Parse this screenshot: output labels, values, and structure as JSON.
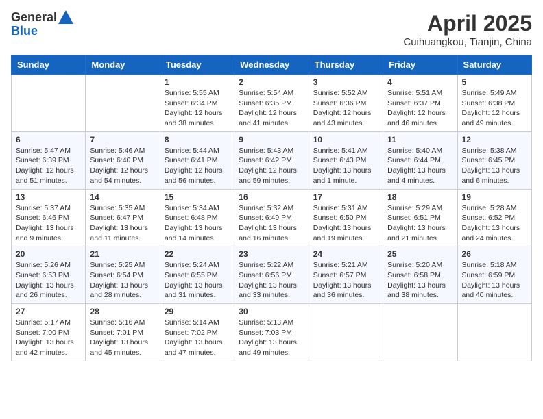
{
  "header": {
    "logo_general": "General",
    "logo_blue": "Blue",
    "month_title": "April 2025",
    "subtitle": "Cuihuangkou, Tianjin, China"
  },
  "weekdays": [
    "Sunday",
    "Monday",
    "Tuesday",
    "Wednesday",
    "Thursday",
    "Friday",
    "Saturday"
  ],
  "weeks": [
    [
      {
        "day": "",
        "sunrise": "",
        "sunset": "",
        "daylight": ""
      },
      {
        "day": "",
        "sunrise": "",
        "sunset": "",
        "daylight": ""
      },
      {
        "day": "1",
        "sunrise": "Sunrise: 5:55 AM",
        "sunset": "Sunset: 6:34 PM",
        "daylight": "Daylight: 12 hours and 38 minutes."
      },
      {
        "day": "2",
        "sunrise": "Sunrise: 5:54 AM",
        "sunset": "Sunset: 6:35 PM",
        "daylight": "Daylight: 12 hours and 41 minutes."
      },
      {
        "day": "3",
        "sunrise": "Sunrise: 5:52 AM",
        "sunset": "Sunset: 6:36 PM",
        "daylight": "Daylight: 12 hours and 43 minutes."
      },
      {
        "day": "4",
        "sunrise": "Sunrise: 5:51 AM",
        "sunset": "Sunset: 6:37 PM",
        "daylight": "Daylight: 12 hours and 46 minutes."
      },
      {
        "day": "5",
        "sunrise": "Sunrise: 5:49 AM",
        "sunset": "Sunset: 6:38 PM",
        "daylight": "Daylight: 12 hours and 49 minutes."
      }
    ],
    [
      {
        "day": "6",
        "sunrise": "Sunrise: 5:47 AM",
        "sunset": "Sunset: 6:39 PM",
        "daylight": "Daylight: 12 hours and 51 minutes."
      },
      {
        "day": "7",
        "sunrise": "Sunrise: 5:46 AM",
        "sunset": "Sunset: 6:40 PM",
        "daylight": "Daylight: 12 hours and 54 minutes."
      },
      {
        "day": "8",
        "sunrise": "Sunrise: 5:44 AM",
        "sunset": "Sunset: 6:41 PM",
        "daylight": "Daylight: 12 hours and 56 minutes."
      },
      {
        "day": "9",
        "sunrise": "Sunrise: 5:43 AM",
        "sunset": "Sunset: 6:42 PM",
        "daylight": "Daylight: 12 hours and 59 minutes."
      },
      {
        "day": "10",
        "sunrise": "Sunrise: 5:41 AM",
        "sunset": "Sunset: 6:43 PM",
        "daylight": "Daylight: 13 hours and 1 minute."
      },
      {
        "day": "11",
        "sunrise": "Sunrise: 5:40 AM",
        "sunset": "Sunset: 6:44 PM",
        "daylight": "Daylight: 13 hours and 4 minutes."
      },
      {
        "day": "12",
        "sunrise": "Sunrise: 5:38 AM",
        "sunset": "Sunset: 6:45 PM",
        "daylight": "Daylight: 13 hours and 6 minutes."
      }
    ],
    [
      {
        "day": "13",
        "sunrise": "Sunrise: 5:37 AM",
        "sunset": "Sunset: 6:46 PM",
        "daylight": "Daylight: 13 hours and 9 minutes."
      },
      {
        "day": "14",
        "sunrise": "Sunrise: 5:35 AM",
        "sunset": "Sunset: 6:47 PM",
        "daylight": "Daylight: 13 hours and 11 minutes."
      },
      {
        "day": "15",
        "sunrise": "Sunrise: 5:34 AM",
        "sunset": "Sunset: 6:48 PM",
        "daylight": "Daylight: 13 hours and 14 minutes."
      },
      {
        "day": "16",
        "sunrise": "Sunrise: 5:32 AM",
        "sunset": "Sunset: 6:49 PM",
        "daylight": "Daylight: 13 hours and 16 minutes."
      },
      {
        "day": "17",
        "sunrise": "Sunrise: 5:31 AM",
        "sunset": "Sunset: 6:50 PM",
        "daylight": "Daylight: 13 hours and 19 minutes."
      },
      {
        "day": "18",
        "sunrise": "Sunrise: 5:29 AM",
        "sunset": "Sunset: 6:51 PM",
        "daylight": "Daylight: 13 hours and 21 minutes."
      },
      {
        "day": "19",
        "sunrise": "Sunrise: 5:28 AM",
        "sunset": "Sunset: 6:52 PM",
        "daylight": "Daylight: 13 hours and 24 minutes."
      }
    ],
    [
      {
        "day": "20",
        "sunrise": "Sunrise: 5:26 AM",
        "sunset": "Sunset: 6:53 PM",
        "daylight": "Daylight: 13 hours and 26 minutes."
      },
      {
        "day": "21",
        "sunrise": "Sunrise: 5:25 AM",
        "sunset": "Sunset: 6:54 PM",
        "daylight": "Daylight: 13 hours and 28 minutes."
      },
      {
        "day": "22",
        "sunrise": "Sunrise: 5:24 AM",
        "sunset": "Sunset: 6:55 PM",
        "daylight": "Daylight: 13 hours and 31 minutes."
      },
      {
        "day": "23",
        "sunrise": "Sunrise: 5:22 AM",
        "sunset": "Sunset: 6:56 PM",
        "daylight": "Daylight: 13 hours and 33 minutes."
      },
      {
        "day": "24",
        "sunrise": "Sunrise: 5:21 AM",
        "sunset": "Sunset: 6:57 PM",
        "daylight": "Daylight: 13 hours and 36 minutes."
      },
      {
        "day": "25",
        "sunrise": "Sunrise: 5:20 AM",
        "sunset": "Sunset: 6:58 PM",
        "daylight": "Daylight: 13 hours and 38 minutes."
      },
      {
        "day": "26",
        "sunrise": "Sunrise: 5:18 AM",
        "sunset": "Sunset: 6:59 PM",
        "daylight": "Daylight: 13 hours and 40 minutes."
      }
    ],
    [
      {
        "day": "27",
        "sunrise": "Sunrise: 5:17 AM",
        "sunset": "Sunset: 7:00 PM",
        "daylight": "Daylight: 13 hours and 42 minutes."
      },
      {
        "day": "28",
        "sunrise": "Sunrise: 5:16 AM",
        "sunset": "Sunset: 7:01 PM",
        "daylight": "Daylight: 13 hours and 45 minutes."
      },
      {
        "day": "29",
        "sunrise": "Sunrise: 5:14 AM",
        "sunset": "Sunset: 7:02 PM",
        "daylight": "Daylight: 13 hours and 47 minutes."
      },
      {
        "day": "30",
        "sunrise": "Sunrise: 5:13 AM",
        "sunset": "Sunset: 7:03 PM",
        "daylight": "Daylight: 13 hours and 49 minutes."
      },
      {
        "day": "",
        "sunrise": "",
        "sunset": "",
        "daylight": ""
      },
      {
        "day": "",
        "sunrise": "",
        "sunset": "",
        "daylight": ""
      },
      {
        "day": "",
        "sunrise": "",
        "sunset": "",
        "daylight": ""
      }
    ]
  ]
}
